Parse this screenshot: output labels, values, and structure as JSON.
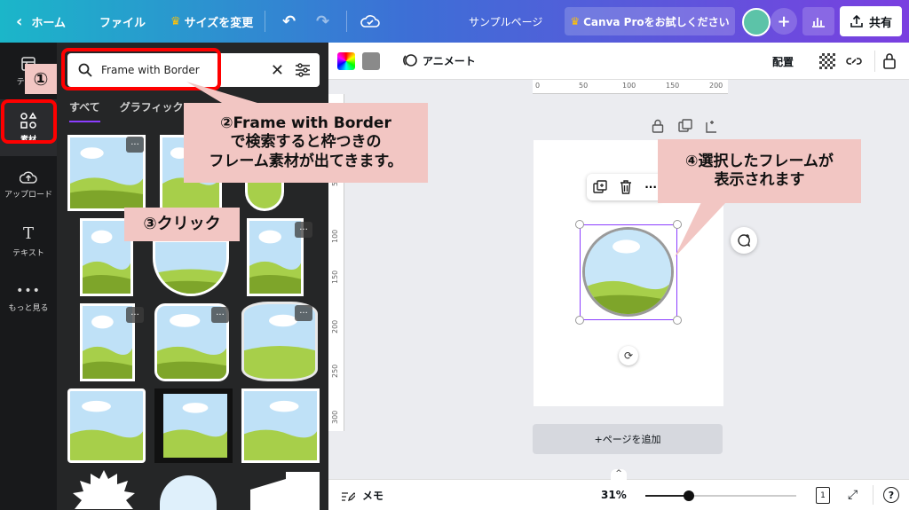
{
  "topbar": {
    "home": "ホーム",
    "file": "ファイル",
    "resize": "サイズを変更",
    "doc_title": "サンプルページ",
    "pro_label": "Canva Proをお試しください",
    "share": "共有"
  },
  "rail": {
    "items": [
      {
        "label": "テンプ",
        "icon": "template-icon"
      },
      {
        "label": "素材",
        "icon": "elements-icon"
      },
      {
        "label": "アップロード",
        "icon": "upload-icon"
      },
      {
        "label": "テキスト",
        "icon": "text-icon"
      },
      {
        "label": "もっと見る",
        "icon": "more-icon"
      }
    ]
  },
  "panel": {
    "search_value": "Frame with Border",
    "tabs": [
      "すべて",
      "グラフィック"
    ]
  },
  "toolbar": {
    "animate": "アニメート",
    "position": "配置"
  },
  "ruler": {
    "h": [
      "0",
      "50",
      "100",
      "150",
      "200"
    ],
    "v": [
      "50",
      "100",
      "150",
      "200",
      "250",
      "300"
    ]
  },
  "canvas": {
    "add_page": "+ページを追加"
  },
  "bottombar": {
    "notes": "メモ",
    "zoom": "31%",
    "zoom_level": 0.31,
    "page_count": "1"
  },
  "annotations": {
    "num1": "①",
    "callout2": [
      "②Frame with Border",
      "で検索すると枠つきの",
      "フレーム素材が出てきます。"
    ],
    "callout3": "③クリック",
    "callout4": [
      "④選択したフレームが",
      "表示されます"
    ]
  },
  "colors": {
    "accent": "#8b3dff",
    "annotation_red": "#ff0000",
    "callout_bg": "#f2c6c3"
  }
}
